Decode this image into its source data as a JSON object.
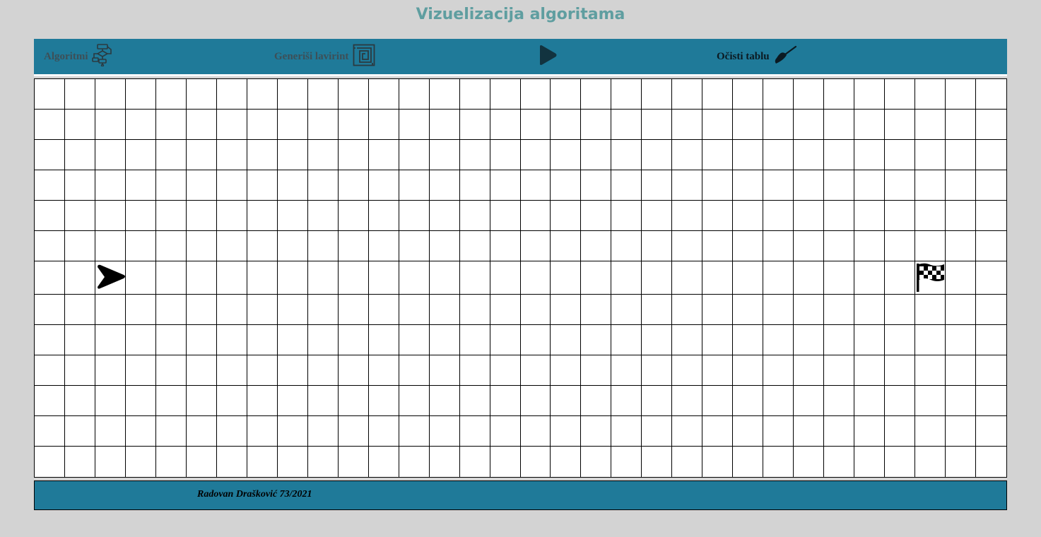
{
  "header": {
    "title": "Vizuelizacija algoritama"
  },
  "toolbar": {
    "algorithms_label": "Algoritmi",
    "algorithms_icon": "flowchart-icon",
    "maze_label": "Generiši lavirint",
    "maze_icon": "maze-icon",
    "play_icon": "play-icon",
    "clear_label": "Očisti tablu",
    "clear_icon": "broom-icon"
  },
  "grid": {
    "rows": 13,
    "cols": 32,
    "start": {
      "row": 7,
      "col": 3,
      "icon": "arrow-right-icon"
    },
    "finish": {
      "row": 7,
      "col": 30,
      "icon": "checkered-flag-icon"
    }
  },
  "footer": {
    "author": "Radovan Drašković 73/2021"
  },
  "colors": {
    "background": "#d3d3d3",
    "title": "#5f9ea0",
    "bar": "#1f7a99",
    "cell": "#ffffff"
  }
}
